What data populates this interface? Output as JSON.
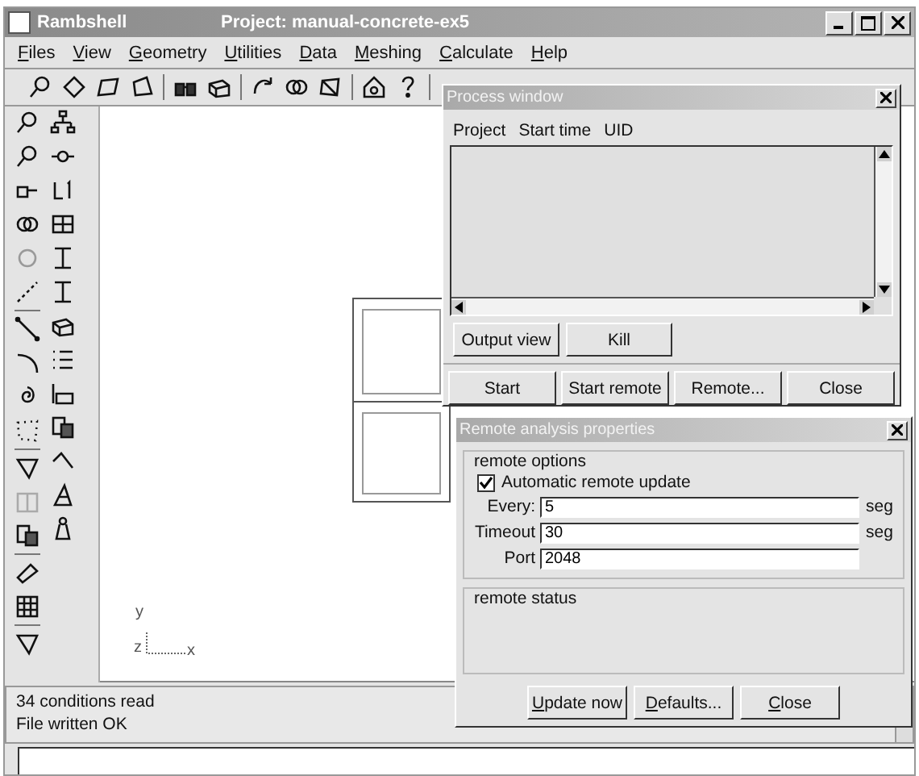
{
  "window": {
    "app_name": "Rambshell",
    "project": "Project: manual-concrete-ex5"
  },
  "menu": [
    {
      "accel": "F",
      "rest": "iles"
    },
    {
      "accel": "V",
      "rest": "iew"
    },
    {
      "accel": "G",
      "rest": "eometry"
    },
    {
      "accel": "U",
      "rest": "tilities"
    },
    {
      "accel": "D",
      "rest": "ata"
    },
    {
      "accel": "M",
      "rest": "eshing"
    },
    {
      "accel": "C",
      "rest": "alculate"
    },
    {
      "accel": "H",
      "rest": "elp"
    }
  ],
  "canvas": {
    "axis_labels": [
      "y",
      "z",
      "x"
    ]
  },
  "status_lines": [
    "34 conditions read",
    "File written OK"
  ],
  "process_window": {
    "title": "Process window",
    "columns": [
      "Project",
      "Start time",
      "UID"
    ],
    "buttons_top": [
      {
        "label": "Output view"
      },
      {
        "label": "Kill"
      }
    ],
    "buttons_bottom": [
      {
        "label": "Start"
      },
      {
        "label": "Start remote"
      },
      {
        "label": "Remote..."
      },
      {
        "label": "Close"
      }
    ]
  },
  "remote_dialog": {
    "title": "Remote analysis properties",
    "options_group": "remote options",
    "checkbox": {
      "label": "Automatic remote update",
      "checked": true
    },
    "fields": [
      {
        "label": "Every:",
        "value": "5",
        "unit": "seg"
      },
      {
        "label": "Timeout",
        "value": "30",
        "unit": "seg"
      },
      {
        "label": "Port",
        "value": "2048"
      }
    ],
    "status_group": "remote status",
    "buttons": [
      {
        "accel": "U",
        "rest": "pdate now"
      },
      {
        "accel": "D",
        "rest": "efaults..."
      },
      {
        "accel": "C",
        "rest": "lose"
      }
    ]
  }
}
